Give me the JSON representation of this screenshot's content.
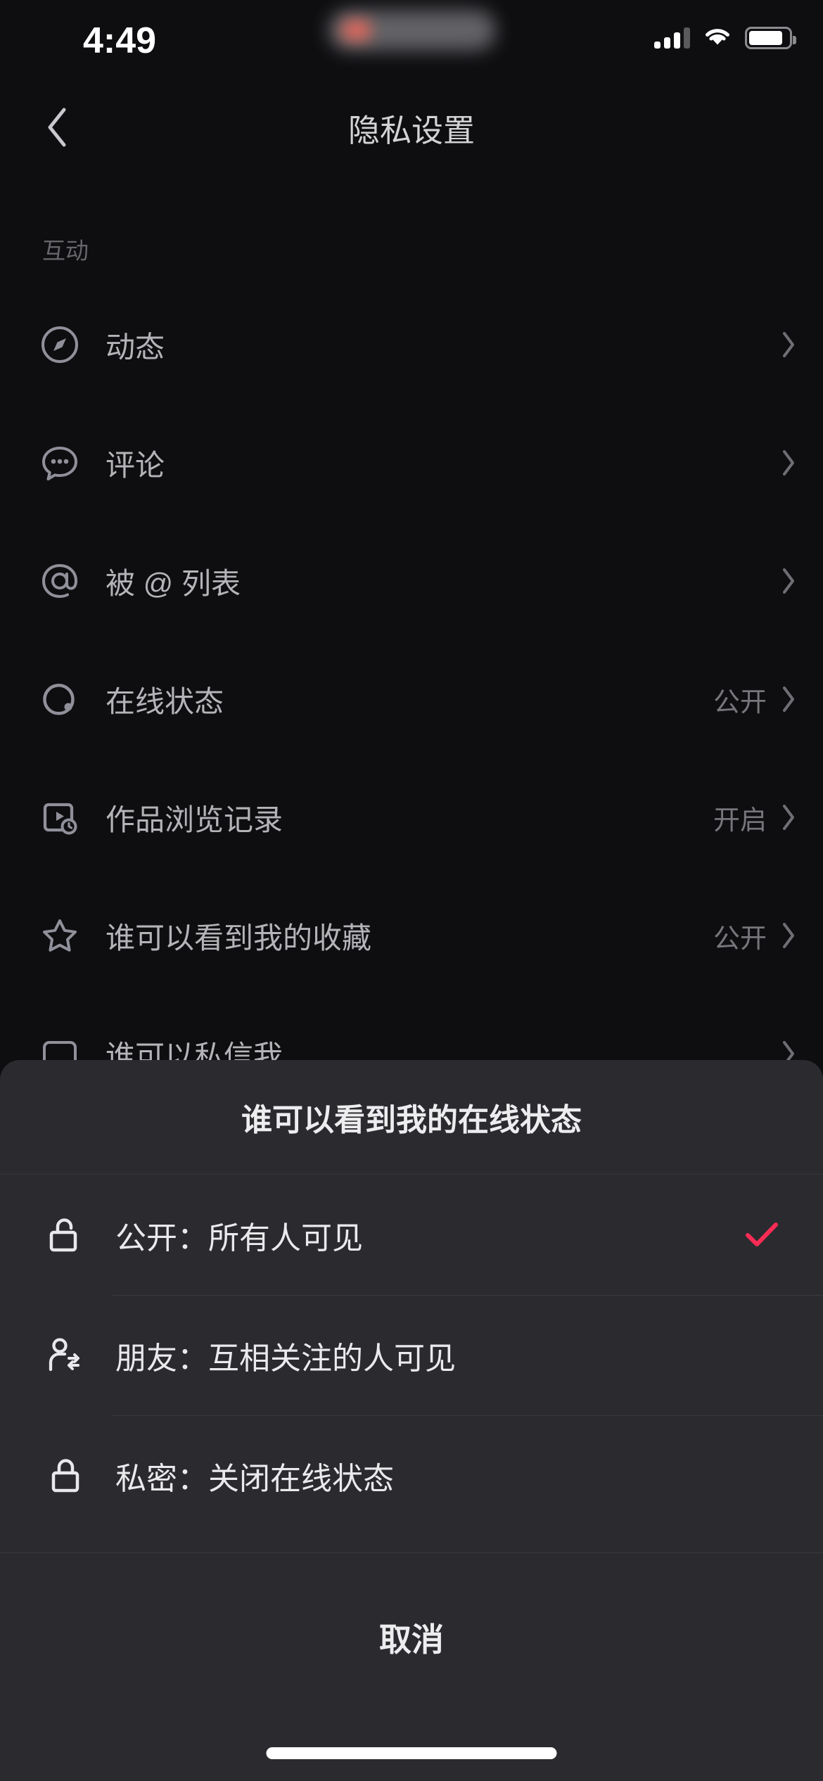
{
  "status_bar": {
    "time": "4:49",
    "signal_icon": "cellular-signal-icon",
    "wifi_icon": "wifi-icon",
    "battery_icon": "battery-icon"
  },
  "header": {
    "title": "隐私设置",
    "back_icon": "chevron-left-icon"
  },
  "list": {
    "section_label": "互动",
    "items": [
      {
        "icon": "compass-icon",
        "label": "动态",
        "value": "",
        "chevron": "chevron-right-icon"
      },
      {
        "icon": "comment-bubble-icon",
        "label": "评论",
        "value": "",
        "chevron": "chevron-right-icon"
      },
      {
        "icon": "at-sign-icon",
        "label": "被 @ 列表",
        "value": "",
        "chevron": "chevron-right-icon"
      },
      {
        "icon": "online-status-icon",
        "label": "在线状态",
        "value": "公开",
        "chevron": "chevron-right-icon"
      },
      {
        "icon": "video-history-icon",
        "label": "作品浏览记录",
        "value": "开启",
        "chevron": "chevron-right-icon"
      },
      {
        "icon": "star-icon",
        "label": "谁可以看到我的收藏",
        "value": "公开",
        "chevron": "chevron-right-icon"
      },
      {
        "icon": "message-icon",
        "label": "谁可以私信我",
        "value": "",
        "chevron": "chevron-right-icon"
      }
    ]
  },
  "sheet": {
    "title": "谁可以看到我的在线状态",
    "options": [
      {
        "icon": "unlock-icon",
        "label": "公开：所有人可见",
        "selected": true,
        "check_icon": "check-icon"
      },
      {
        "icon": "person-swap-icon",
        "label": "朋友：互相关注的人可见",
        "selected": false,
        "check_icon": ""
      },
      {
        "icon": "lock-icon",
        "label": "私密：关闭在线状态",
        "selected": false,
        "check_icon": ""
      }
    ],
    "cancel_label": "取消"
  },
  "colors": {
    "page_background": "#0e0e11",
    "sheet_background": "#2b2b2f",
    "accent_check": "#fe2c55",
    "primary_text": "#eaeaec",
    "secondary_text": "#b4b4b8",
    "muted_text": "#76767b"
  }
}
